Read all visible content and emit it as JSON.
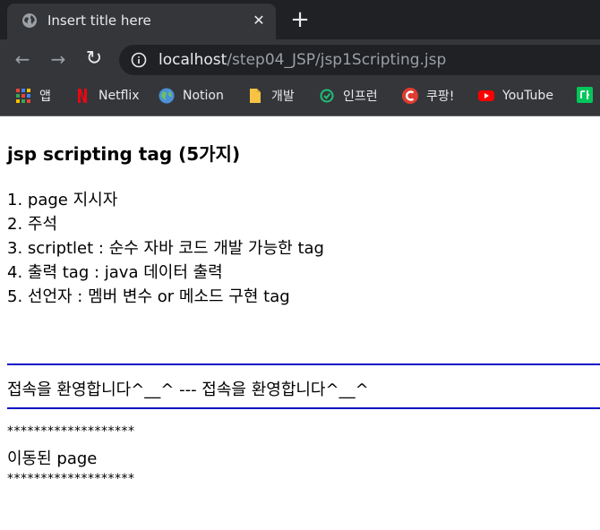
{
  "browser": {
    "tab_title": "Insert title here",
    "new_tab_glyph": "+",
    "close_glyph": "✕",
    "url_host": "localhost",
    "url_path": "/step04_JSP/jsp1Scripting.jsp",
    "bookmarks": [
      {
        "label": "앱",
        "icon": "apps-grid-icon"
      },
      {
        "label": "Netflix",
        "icon": "netflix-icon"
      },
      {
        "label": "Notion",
        "icon": "notion-globe-icon"
      },
      {
        "label": "개발",
        "icon": "folder-icon"
      },
      {
        "label": "인프런",
        "icon": "inflearn-icon"
      },
      {
        "label": "쿠팡!",
        "icon": "coupang-icon"
      },
      {
        "label": "YouTube",
        "icon": "youtube-icon"
      }
    ]
  },
  "content": {
    "heading": "jsp scripting tag (5가지)",
    "items": [
      "1. page 지시자",
      "2. 주석",
      "3. scriptlet : 순수 자바 코드 개발 가능한 tag",
      "4. 출력 tag : java 데이터 출력",
      "5. 선언자 : 멤버 변수 or 메소드 구현 tag"
    ],
    "welcome": "접속을 환영합니다^__^ --- 접속을 환영합니다^__^",
    "stars_top": "*******************",
    "moved": "이동된 page",
    "stars_bottom": "*******************"
  },
  "colors": {
    "tabstrip": "#202124",
    "toolbar": "#35363a",
    "hr_blue": "#1010c8"
  }
}
